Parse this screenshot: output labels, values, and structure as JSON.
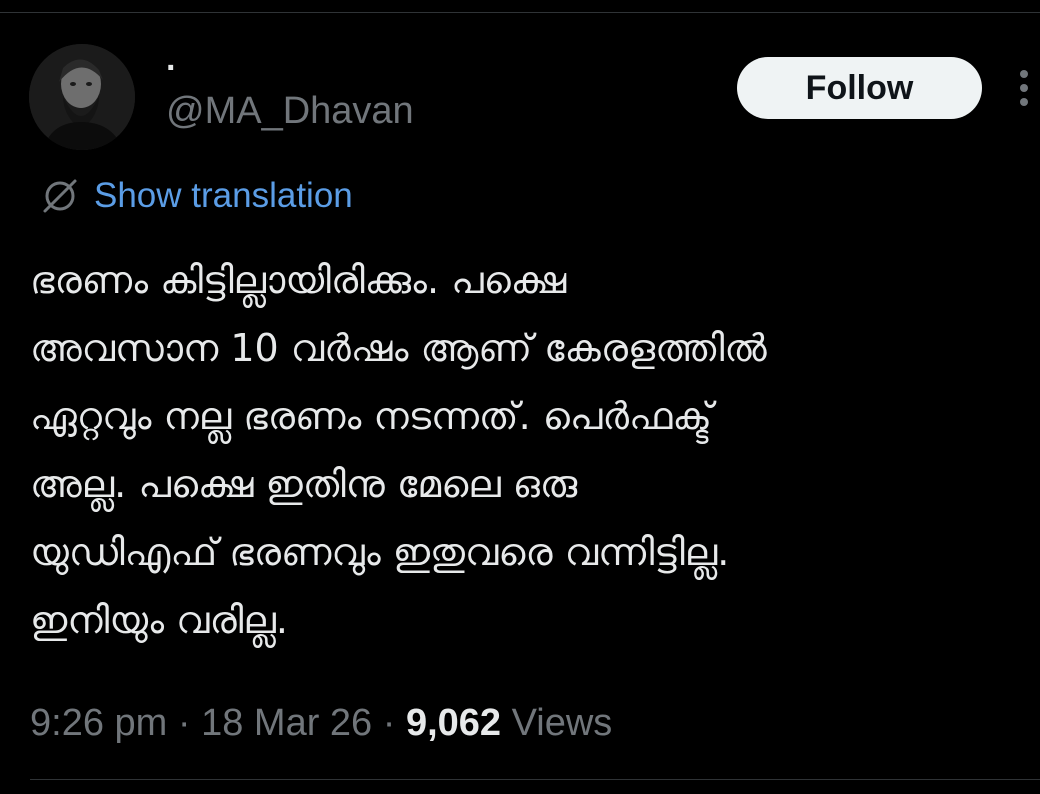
{
  "author": {
    "display_name": "·",
    "handle": "@MA_Dhavan"
  },
  "follow_label": "Follow",
  "translation_label": "Show translation",
  "tweet_lines": [
    "ഭരണം കിട്ടില്ലായിരിക്കും. പക്ഷെ",
    "അവസാന 10 വർഷം ആണ് കേരളത്തിൽ",
    "ഏറ്റവും നല്ല ഭരണം നടന്നത്. പെർഫക്ട്",
    "അല്ല. പക്ഷെ ഇതിനു മേലെ ഒരു",
    "യുഡിഎഫ് ഭരണവും ഇതുവരെ വന്നിട്ടില്ല.",
    "ഇനിയും വരില്ല."
  ],
  "meta": {
    "time": "9:26 pm",
    "sep1": " · ",
    "date": "18 Mar 26",
    "sep2": " · ",
    "views_count": "9,062",
    "views_label": " Views"
  },
  "icons": {
    "avatar": "profile-photo",
    "more": "more-vertical-icon",
    "translate": "globe-slash-icon"
  },
  "colors": {
    "background": "#000000",
    "link": "#5b9de6",
    "muted": "#71767b",
    "text": "#e7e9ea",
    "button_bg": "#eff3f4"
  }
}
